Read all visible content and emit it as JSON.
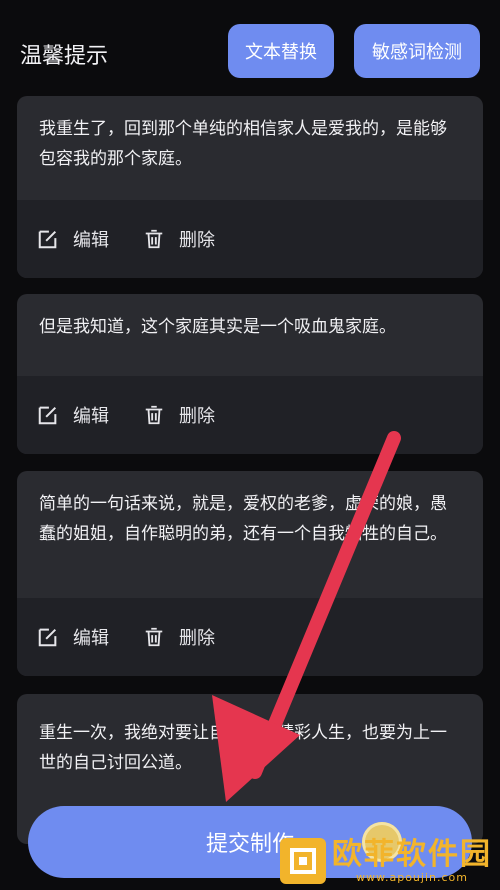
{
  "header": {
    "title": "温馨提示",
    "btn_replace": "文本替换",
    "btn_sensitive": "敏感词检测"
  },
  "cards": [
    {
      "text": "我重生了，回到那个单纯的相信家人是爱我的，是能够包容我的那个家庭。",
      "edit": "编辑",
      "delete": "删除"
    },
    {
      "text": "但是我知道，这个家庭其实是一个吸血鬼家庭。",
      "edit": "编辑",
      "delete": "删除"
    },
    {
      "text": "简单的一句话来说，就是，爱权的老爹，虚荣的娘，愚蠢的姐姐，自作聪明的弟，还有一个自我牺牲的自己。",
      "edit": "编辑",
      "delete": "删除"
    },
    {
      "text": "重生一次，我绝对要让自己活出精彩人生，也要为上一世的自己讨回公道。"
    }
  ],
  "submit": "提交制作",
  "watermark": {
    "main": "欧菲软件园",
    "sub": "www.apoujin.com"
  },
  "colors": {
    "accent": "#6f8cf0",
    "arrow": "#e5364f",
    "card": "#2a2b30"
  }
}
